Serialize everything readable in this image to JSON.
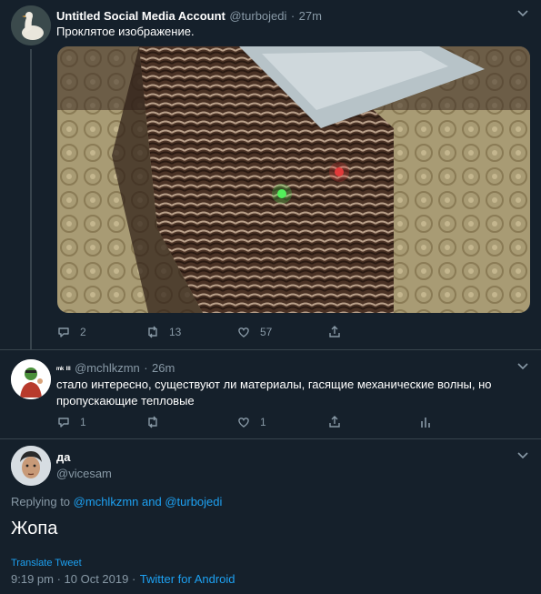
{
  "tweet1": {
    "name": "Untitled Social Media Account",
    "handle": "@turbojedi",
    "sep": "·",
    "time": "27m",
    "text": "Проклятое изображение.",
    "replies": "2",
    "retweets": "13",
    "likes": "57"
  },
  "tweet2": {
    "name": "ᵐᵏ ᴵᴵᴵ",
    "handle": "@mchlkzmn",
    "sep": "·",
    "time": "26m",
    "text": "стало интересно, существуют ли материалы, гасящие механические волны, но пропускающие тепловые",
    "replies": "1",
    "likes": "1"
  },
  "main_tweet": {
    "name": "да",
    "handle": "@vicesam",
    "replying_prefix": "Replying to",
    "replying_user1": "@mchlkzmn",
    "replying_and": "and",
    "replying_user2": "@turbojedi",
    "text": "Жопа",
    "translate": "Translate Tweet",
    "timestamp": "9:19 pm · 10 Oct 2019 ·",
    "client": "Twitter for Android"
  },
  "colors": {
    "background": "#15202b",
    "accent": "#1da1f2",
    "muted": "#8899a6",
    "divider": "#38444d"
  },
  "icons": [
    "reply-icon",
    "retweet-icon",
    "like-icon",
    "share-icon",
    "analytics-icon",
    "chevron-down-icon"
  ]
}
